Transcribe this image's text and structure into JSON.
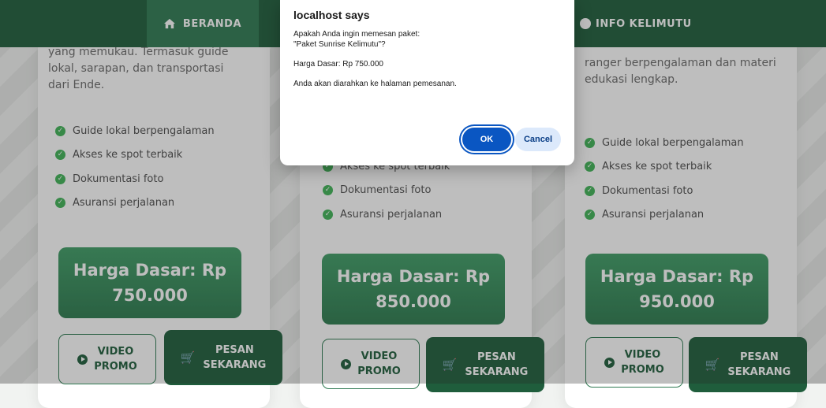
{
  "nav": {
    "beranda_label": "BERANDA",
    "info_label": "INFO KELIMUTU"
  },
  "cards": [
    {
      "description": "yang memukau. Termasuk guide\nlokal, sarapan, dan transportasi\ndari Ende.",
      "features": [
        "Guide lokal berpengalaman",
        "Akses ke spot terbaik",
        "Dokumentasi foto",
        "Asuransi perjalanan"
      ],
      "price": "Harga Dasar: Rp\n750.000",
      "video_label": "VIDEO\nPROMO",
      "order_label": "PESAN\nSEKARANG"
    },
    {
      "description": "",
      "features": [
        "Akses ke spot terbaik",
        "Dokumentasi foto",
        "Asuransi perjalanan"
      ],
      "price": "Harga Dasar: Rp\n850.000",
      "video_label": "VIDEO\nPROMO",
      "order_label": "PESAN\nSEKARANG"
    },
    {
      "description": "ranger berpengalaman dan materi\nedukasi lengkap.",
      "features": [
        "Guide lokal berpengalaman",
        "Akses ke spot terbaik",
        "Dokumentasi foto",
        "Asuransi perjalanan"
      ],
      "price": "Harga Dasar: Rp\n950.000",
      "video_label": "VIDEO\nPROMO",
      "order_label": "PESAN\nSEKARANG"
    }
  ],
  "dialog": {
    "title": "localhost says",
    "message": "Apakah Anda ingin memesan paket:\n\"Paket Sunrise Kelimutu\"?\n\nHarga Dasar: Rp 750.000\n\nAnda akan diarahkan ke halaman pemesanan.",
    "ok_label": "OK",
    "cancel_label": "Cancel"
  },
  "colors": {
    "brand_dark": "#1f5d3c",
    "brand": "#2f7a52",
    "check": "#3fb357",
    "dialog_ok": "#0a56c2"
  }
}
